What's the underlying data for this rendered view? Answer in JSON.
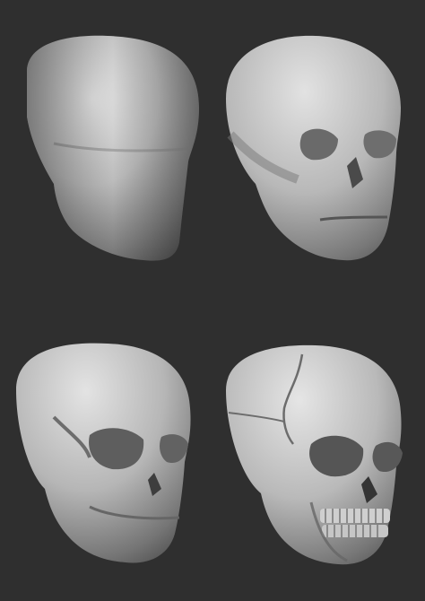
{
  "scene": {
    "background_color": "#2f2f2f",
    "panels": [
      {
        "stage": "blockout",
        "icon": "skull-blockout-icon"
      },
      {
        "stage": "primary-forms",
        "icon": "skull-primary-forms-icon"
      },
      {
        "stage": "secondary-forms",
        "icon": "skull-secondary-forms-icon"
      },
      {
        "stage": "detailed",
        "icon": "skull-detailed-icon"
      }
    ],
    "colors": {
      "surface_light": "#d8d8d8",
      "surface_mid": "#a8a8a8",
      "surface_dark": "#5a5a5a",
      "cavity": "#3a3a3a"
    }
  }
}
